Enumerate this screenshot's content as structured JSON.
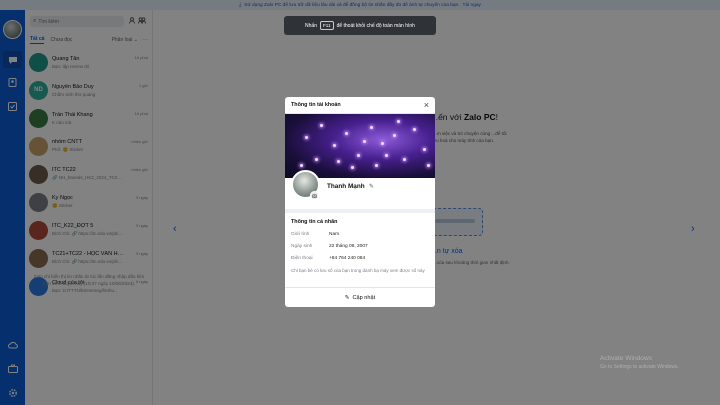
{
  "topbar": {
    "icon": "download-icon",
    "text": "Sử dụng Zalo PC để lưu trữ dữ liệu lâu dài và để đồng bộ tin nhắn đầy đủ để ảnh tự chuyển của bạn.",
    "link": "Tải ngay"
  },
  "rail": {
    "items": [
      "chat-icon",
      "contacts-icon",
      "todo-icon",
      "cloud-icon",
      "briefcase-icon",
      "settings-icon"
    ]
  },
  "sidebar": {
    "search_placeholder": "Tìm kiếm",
    "tabs": {
      "all": "Tất cả",
      "unread": "Chưa đọc",
      "filter": "Phân loại ⌄",
      "more": "···"
    },
    "conversations": [
      {
        "name": "Quang Tân",
        "message": "Bạn: tập review đó",
        "time": "16 phút",
        "avatar_color": "#1f9c8c",
        "initials": ""
      },
      {
        "name": "Nguyễn Bảo Duy",
        "message": "Chấm sinh thử quang",
        "time": "1 giờ",
        "avatar_color": "#2fae9b",
        "initials": "ND"
      },
      {
        "name": "Trần Thái Khang",
        "message": "K nào mà",
        "time": "16 phút",
        "avatar_color": "#3a7d44",
        "initials": ""
      },
      {
        "name": "nhóm CNTT",
        "message": "Phố: 🙂 Sticker",
        "time": "nhiều giờ",
        "avatar_color": "#c9a26b",
        "initials": ""
      },
      {
        "name": "ITC TC22",
        "message": "🔗 NH_baneds_HK2_2024_TC22th.xlsx",
        "time": "nhiều giờ",
        "avatar_color": "#6d5a4a",
        "initials": ""
      },
      {
        "name": "Ky Ngọc",
        "message": "🙂 Sticker",
        "time": "3 ngày",
        "avatar_color": "#7a7f88",
        "initials": ""
      },
      {
        "name": "ITC_K22_ĐỢT 5",
        "message": "Bích Chi: 🔗 https://itc.edu.vn/phi-th...",
        "time": "3 ngày",
        "avatar_color": "#b04a3a",
        "initials": ""
      },
      {
        "name": "TC21+TC22 - HỌC VĂN HOÁ",
        "message": "Bích Chi: 🔗 https://itc.edu.vn/phi-th...",
        "time": "3 ngày",
        "avatar_color": "#8a6d4f",
        "initials": ""
      },
      {
        "name": "Cloud của tôi",
        "message": "Bạn: D:/TTTN/btrentrang/htnhu...",
        "time": "6 ngày",
        "avatar_color": "#2a7be4",
        "initials": ""
      }
    ],
    "note": "Zalo chỉ hiển thị tin nhắn từ lúc lần đăng nhập đầu tiên trên trình duyệt này (10:37 ngày 10/06/2024)."
  },
  "main": {
    "welcome_prefix": "...ến với ",
    "welcome_brand": "Zalo PC",
    "welcome_suffix": "!",
    "description": "...m việc và trò chuyện cùng ...để tối ưu hoá cho máy tính của bạn.",
    "feature_title": "...n tự xóa",
    "feature_desc": "...xóa sau khoảng thời gian nhất định."
  },
  "toast": {
    "prefix": "Nhấn",
    "key": "F11",
    "suffix": "để thoát khỏi chế độ toàn màn hình"
  },
  "modal": {
    "title": "Thông tin tài khoản",
    "name": "Thanh Mạnh",
    "section_title": "Thông tin cá nhân",
    "fields": [
      {
        "label": "Giới tính",
        "value": "Nam"
      },
      {
        "label": "Ngày sinh",
        "value": "22 tháng 09, 2007"
      },
      {
        "label": "Điện thoại",
        "value": "+84 764 240 084"
      }
    ],
    "note": "Chỉ bạn bè có lưu số của bạn trong danh bạ máy xem được số này",
    "update_label": "Cập nhật"
  },
  "watermark": {
    "line1": "Activate Windows",
    "line2": "Go to Settings to activate Windows."
  }
}
